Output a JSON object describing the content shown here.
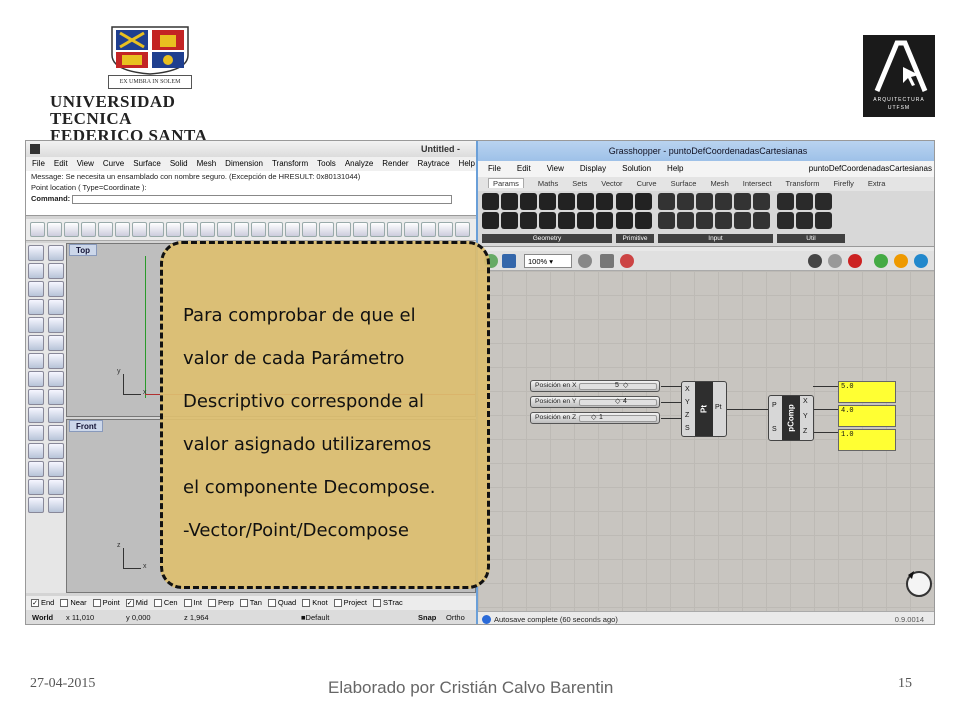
{
  "header": {
    "crest_motto_left": "EX UMBRA",
    "crest_motto_mid": "IN",
    "crest_motto_right": "SOLEM",
    "university_line1": "UNIVERSIDAD TECNICA",
    "university_line2": "FEDERICO SANTA MARIA",
    "arq_subtitle_1": "ARQUITECTURA",
    "arq_subtitle_2": "UTFSM"
  },
  "rhino": {
    "title": "Untitled - Rhino",
    "menu": [
      "File",
      "Edit",
      "View",
      "Curve",
      "Surface",
      "Solid",
      "Mesh",
      "Dimension",
      "Transform",
      "Tools",
      "Analyze",
      "Render",
      "Raytrace",
      "Help"
    ],
    "message": "Message: Se necesita un ensamblado con nombre seguro. (Excepción de HRESULT: 0x80131044)",
    "prompt": "Point location ( Type=Coordinate ):",
    "command_label": "Command:",
    "viewport_top": "Top",
    "viewport_front": "Front",
    "axis_x": "x",
    "axis_y": "y",
    "axis_z": "z",
    "osnaps": [
      "End",
      "Near",
      "Point",
      "Mid",
      "Cen",
      "Int",
      "Perp",
      "Tan",
      "Quad",
      "Knot",
      "Project",
      "STrac"
    ],
    "osnaps_checked": [
      "End",
      "Mid"
    ],
    "status": {
      "cplane": "World",
      "x": "x 11,010",
      "y": "y 0,000",
      "z": "z 1,964",
      "layer": "Default",
      "snap": "Snap",
      "ortho": "Ortho"
    }
  },
  "grasshopper": {
    "title": "Grasshopper - puntoDefCoordenadasCartesianas",
    "menu": [
      "File",
      "Edit",
      "View",
      "Display",
      "Solution",
      "Help"
    ],
    "doc_name": "puntoDefCoordenadasCartesianas",
    "tabs": [
      "Params",
      "Maths",
      "Sets",
      "Vector",
      "Curve",
      "Surface",
      "Mesh",
      "Intersect",
      "Transform",
      "Firefly",
      "Extra"
    ],
    "active_tab": "Params",
    "ribbon_groups": [
      "Geometry",
      "Primitive",
      "Input",
      "Util"
    ],
    "zoom": "100%",
    "sliders": [
      {
        "name": "Posición en X",
        "value": "5"
      },
      {
        "name": "Posición en Y",
        "value": "4"
      },
      {
        "name": "Posición en Z",
        "value": "1"
      }
    ],
    "construct_point": {
      "label": "Pt",
      "inputs": [
        "X",
        "Y",
        "Z",
        "S"
      ],
      "output": "Pt"
    },
    "decompose": {
      "label": "pComp",
      "inputs": [
        "P",
        "S"
      ],
      "outputs": [
        "X",
        "Y",
        "Z"
      ]
    },
    "panels": [
      "5.0",
      "4.0",
      "1.0"
    ],
    "status": "Autosave complete (60 seconds ago)",
    "version": "0.9.0014"
  },
  "note": {
    "lines": [
      "Para comprobar de que el",
      "valor de cada Parámetro",
      "Descriptivo corresponde al",
      "valor asignado utilizaremos",
      "el componente Decompose.",
      "-Vector/Point/Decompose"
    ]
  },
  "footer": {
    "date": "27-04-2015",
    "author": "Elaborado por Cristián Calvo Barentin",
    "page": "15"
  },
  "colors": {
    "note_fill": "#ddbe70",
    "panel_yellow": "#ffff33",
    "rhino_viewport": "#bebebe",
    "gh_canvas": "#c8c5c0"
  }
}
